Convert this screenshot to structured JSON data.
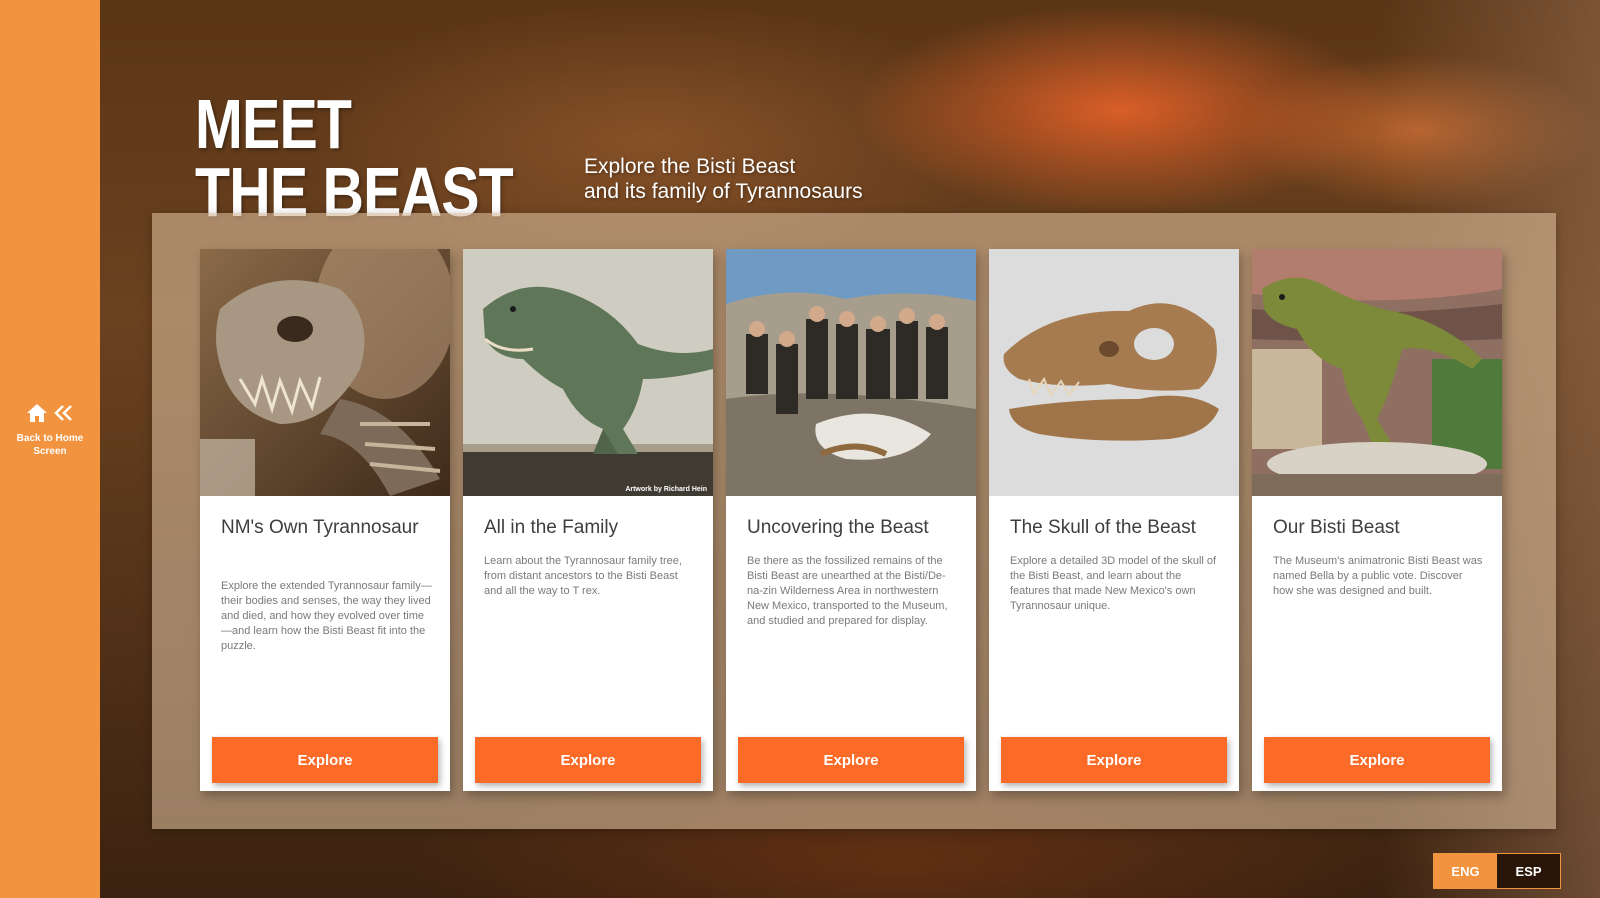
{
  "sidebar": {
    "home_label": "Back to Home Screen"
  },
  "header": {
    "title_line1": "MEET",
    "title_line2": "THE BEAST",
    "subtitle_line1": "Explore the Bisti Beast",
    "subtitle_line2": "and its family of Tyrannosaurs"
  },
  "cards": [
    {
      "title": "NM's Own Tyrannosaur",
      "description": "Explore the extended Tyrannosaur family—their bodies and senses, the way they lived and died, and how they evolved over time—and learn how the Bisti Beast fit into the puzzle.",
      "button": "Explore"
    },
    {
      "title": "All in the Family",
      "description": "Learn about the Tyrannosaur family tree, from distant ancestors to the Bisti Beast and all the way to T rex.",
      "button": "Explore",
      "image_credit": "Artwork by Richard Hein"
    },
    {
      "title": "Uncovering the Beast",
      "description": "Be there as the fossilized remains of the Bisti Beast are unearthed at the Bisti/De-na-zin Wilderness Area in northwestern New Mexico, transported to the Museum, and studied and prepared for display.",
      "button": "Explore"
    },
    {
      "title": "The Skull of the Beast",
      "description": "Explore a detailed 3D model of the skull of the Bisti Beast, and learn about the features that made New Mexico's own Tyrannosaur unique.",
      "button": "Explore"
    },
    {
      "title": "Our Bisti Beast",
      "description": "The Museum's animatronic Bisti Beast was named Bella by a public vote. Discover how she was designed and built.",
      "button": "Explore"
    }
  ],
  "language": {
    "eng": "ENG",
    "esp": "ESP",
    "active": "ENG"
  },
  "colors": {
    "sidebar": "#f2933f",
    "button": "#fb6a26"
  },
  "icons": [
    "home-icon",
    "double-chevron-left-icon"
  ]
}
